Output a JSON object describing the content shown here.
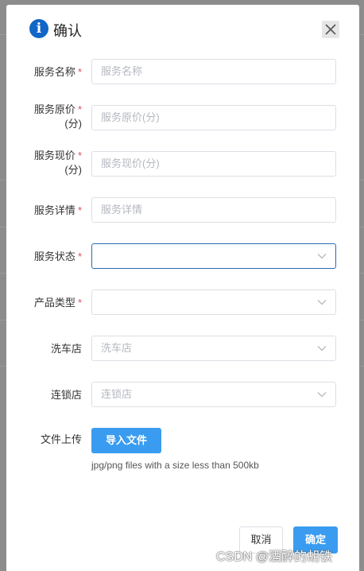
{
  "dialog": {
    "title": "确认",
    "info_icon": "info-icon",
    "close_icon": "close-icon"
  },
  "form": {
    "fields": [
      {
        "label": "服务名称",
        "label_sub": "",
        "required": true,
        "placeholder": "服务名称",
        "type": "input"
      },
      {
        "label": "服务原价",
        "label_sub": "(分)",
        "required": true,
        "placeholder": "服务原价(分)",
        "type": "input"
      },
      {
        "label": "服务现价",
        "label_sub": "(分)",
        "required": true,
        "placeholder": "服务现价(分)",
        "type": "input"
      },
      {
        "label": "服务详情",
        "label_sub": "",
        "required": true,
        "placeholder": "服务详情",
        "type": "input"
      },
      {
        "label": "服务状态",
        "label_sub": "",
        "required": true,
        "placeholder": "",
        "type": "select"
      },
      {
        "label": "产品类型",
        "label_sub": "",
        "required": true,
        "placeholder": "",
        "type": "select"
      },
      {
        "label": "洗车店",
        "label_sub": "",
        "required": false,
        "placeholder": "洗车店",
        "type": "select"
      },
      {
        "label": "连锁店",
        "label_sub": "",
        "required": false,
        "placeholder": "连锁店",
        "type": "select"
      }
    ],
    "required_mark": "*",
    "upload": {
      "label": "文件上传",
      "button": "导入文件",
      "tip": "jpg/png files with a size less than 500kb"
    }
  },
  "footer": {
    "cancel": "取消",
    "confirm": "确定"
  },
  "watermark": "CSDN @酒醉的胡铁",
  "colors": {
    "primary": "#3a9cf0",
    "required": "#e34d59",
    "focus_border": "#2c68b0",
    "overlay": "#8c8c8c"
  }
}
